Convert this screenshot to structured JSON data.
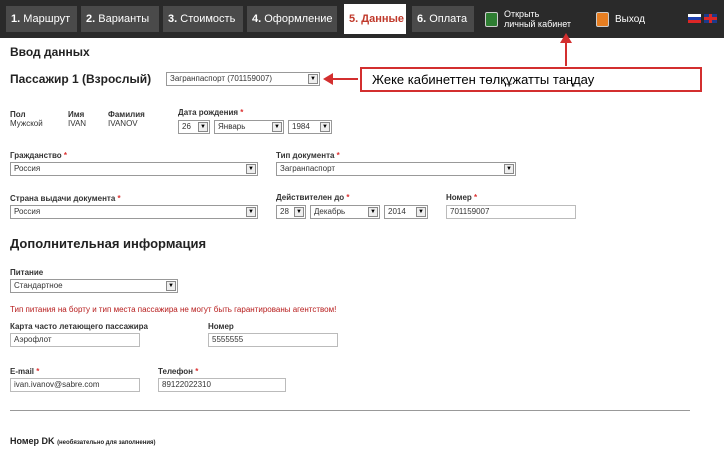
{
  "tabs": [
    {
      "num": "1.",
      "label": "Маршрут"
    },
    {
      "num": "2.",
      "label": "Варианты"
    },
    {
      "num": "3.",
      "label": "Стоимость"
    },
    {
      "num": "4.",
      "label": "Оформление"
    },
    {
      "num": "5.",
      "label": "Данные"
    },
    {
      "num": "6.",
      "label": "Оплата"
    }
  ],
  "cabinet": {
    "line1": "Открыть",
    "line2": "личный кабинет"
  },
  "logout": "Выход",
  "section_title": "Ввод данных",
  "passenger": {
    "title": "Пассажир 1 (Взрослый)",
    "document": "Загранпаспорт (701159007)"
  },
  "callout": "Жеке кабинеттен төлқұжатты таңдау",
  "person": {
    "gender_label": "Пол",
    "gender": "Мужской",
    "name_label": "Имя",
    "name": "IVAN",
    "surname_label": "Фамилия",
    "surname": "IVANOV",
    "birth_label": "Дата рождения",
    "birth_day": "26",
    "birth_month": "Январь",
    "birth_year": "1984"
  },
  "citizenship": {
    "label": "Гражданство",
    "value": "Россия"
  },
  "doc_type": {
    "label": "Тип документа",
    "value": "Загранпаспорт"
  },
  "issue_country": {
    "label": "Страна выдачи документа",
    "value": "Россия"
  },
  "valid_until": {
    "label": "Действителен до",
    "day": "28",
    "month": "Декабрь",
    "year": "2014"
  },
  "number": {
    "label": "Номер",
    "value": "701159007"
  },
  "additional_title": "Дополнительная информация",
  "meal": {
    "label": "Питание",
    "value": "Стандартное"
  },
  "warning": "Тип питания на борту и тип места пассажира не могут быть гарантированы агентством!",
  "ffp": {
    "label": "Карта часто летающего пассажира",
    "value": "Аэрофлот",
    "number_label": "Номер",
    "number": "5555555"
  },
  "email": {
    "label": "E-mail",
    "value": "ivan.ivanov@sabre.com"
  },
  "phone": {
    "label": "Телефон",
    "value": "89122022310"
  },
  "dk": {
    "label": "Номер DK",
    "note": "(необязательно для заполнения)"
  },
  "required_mark": "*",
  "arrow_glyph": "▼",
  "colors": {
    "active_tab": "#c0392b",
    "callout_border": "#d32f2f",
    "warning": "#b71c1c"
  }
}
